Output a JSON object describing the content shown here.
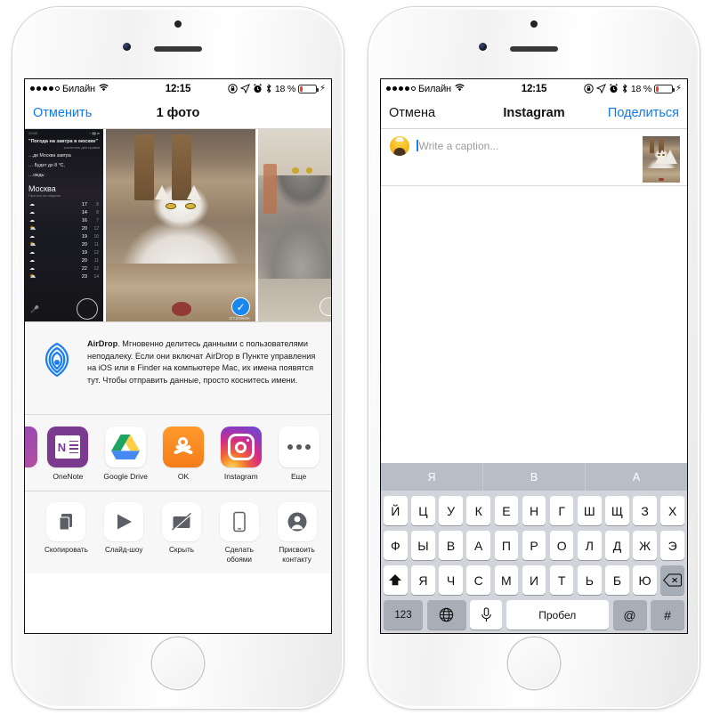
{
  "status_bar": {
    "carrier": "Билайн",
    "wifi_icon": "wifi-icon",
    "time": "12:15",
    "rotation_lock_icon": "rotation-lock-icon",
    "location_icon": "location-arrow-icon",
    "alarm_icon": "alarm-clock-icon",
    "bluetooth_icon": "bluetooth-icon",
    "battery_percent": "18 %",
    "charging_icon": "lightning-bolt-icon"
  },
  "left_phone": {
    "nav": {
      "cancel_label": "Отменить",
      "title": "1 фото"
    },
    "photos": [
      {
        "name": "siri-weather-screenshot",
        "selected": false,
        "weather": {
          "status_time": "23:50",
          "query": "\"Погода на завтра в москве\"",
          "edit_hint": "коснитесь для правки",
          "answer_line1": "…де Москва завтра",
          "answer_line2": "… Будет до 8 °C,",
          "answer_line3": "…ождь:",
          "city": "Москва",
          "city_sub": "Прогноз на неделю",
          "forecast": [
            {
              "icon": "cloud-icon",
              "high": "17",
              "low": "8"
            },
            {
              "icon": "cloud-icon",
              "high": "14",
              "low": "8"
            },
            {
              "icon": "cloud-icon",
              "high": "16",
              "low": "7"
            },
            {
              "icon": "partly-cloudy-icon",
              "high": "20",
              "low": "12"
            },
            {
              "icon": "cloud-icon",
              "high": "19",
              "low": "10"
            },
            {
              "icon": "partly-cloudy-icon",
              "high": "20",
              "low": "11"
            },
            {
              "icon": "cloud-icon",
              "high": "19",
              "low": "12"
            },
            {
              "icon": "cloud-icon",
              "high": "20",
              "low": "11"
            },
            {
              "icon": "cloud-icon",
              "high": "22",
              "low": "12"
            },
            {
              "icon": "partly-cloudy-icon",
              "high": "23",
              "low": "14"
            }
          ],
          "mic_icon": "microphone-icon"
        }
      },
      {
        "name": "white-cat-photo",
        "selected": true,
        "check_icon": "checkmark-icon",
        "watermark": "ОТЗОВИК"
      },
      {
        "name": "grey-cat-photo",
        "selected": false
      }
    ],
    "airdrop": {
      "icon": "airdrop-icon",
      "title": "AirDrop",
      "body": ". Мгновенно делитесь данными с пользователями неподалеку. Если они включат AirDrop в Пункте управления на iOS или в Finder на компьютере Mac, их имена появятся тут. Чтобы отправить данные, просто коснитесь имени."
    },
    "apps": [
      {
        "label": "OneNote",
        "icon": "onenote-icon",
        "glyph": "N"
      },
      {
        "label": "Google Drive",
        "icon": "google-drive-icon"
      },
      {
        "label": "OK",
        "icon": "odnoklassniki-icon"
      },
      {
        "label": "Instagram",
        "icon": "instagram-icon"
      },
      {
        "label": "Еще",
        "icon": "more-ellipsis-icon"
      }
    ],
    "actions": [
      {
        "label": "Скопировать",
        "icon": "copy-icon"
      },
      {
        "label": "Слайд-шоу",
        "icon": "play-slideshow-icon"
      },
      {
        "label": "Скрыть",
        "icon": "hide-slash-icon"
      },
      {
        "label": "Сделать обоями",
        "icon": "wallpaper-phone-icon"
      },
      {
        "label": "Присвоить контакту",
        "icon": "contact-person-icon"
      }
    ]
  },
  "right_phone": {
    "nav": {
      "cancel_label": "Отмена",
      "title": "Instagram",
      "share_label": "Поделиться"
    },
    "composer": {
      "avatar_icon": "user-avatar-icon",
      "caption_placeholder": "Write a caption...",
      "caption_value": "",
      "thumbnail": "white-cat-thumbnail"
    },
    "keyboard": {
      "predictions": [
        "Я",
        "В",
        "А"
      ],
      "row1": [
        "Й",
        "Ц",
        "У",
        "К",
        "Е",
        "Н",
        "Г",
        "Ш",
        "Щ",
        "З",
        "Х"
      ],
      "row2": [
        "Ф",
        "Ы",
        "В",
        "А",
        "П",
        "Р",
        "О",
        "Л",
        "Д",
        "Ж",
        "Э"
      ],
      "row3": [
        "Я",
        "Ч",
        "С",
        "М",
        "И",
        "Т",
        "Ь",
        "Б",
        "Ю"
      ],
      "shift_icon": "shift-arrow-icon",
      "backspace_icon": "backspace-icon",
      "numeric_label": "123",
      "globe_icon": "globe-icon",
      "dictation_icon": "microphone-icon",
      "space_label": "Пробел",
      "at_label": "@",
      "hash_label": "#"
    }
  },
  "colors": {
    "ios_blue": "#0a7bf4",
    "selection_blue": "#1787ef",
    "battery_red": "#f43f36",
    "keyboard_bg": "#d1d4da",
    "predict_bg": "#b8bec7",
    "sheet_bg": "#f7f7f7"
  }
}
